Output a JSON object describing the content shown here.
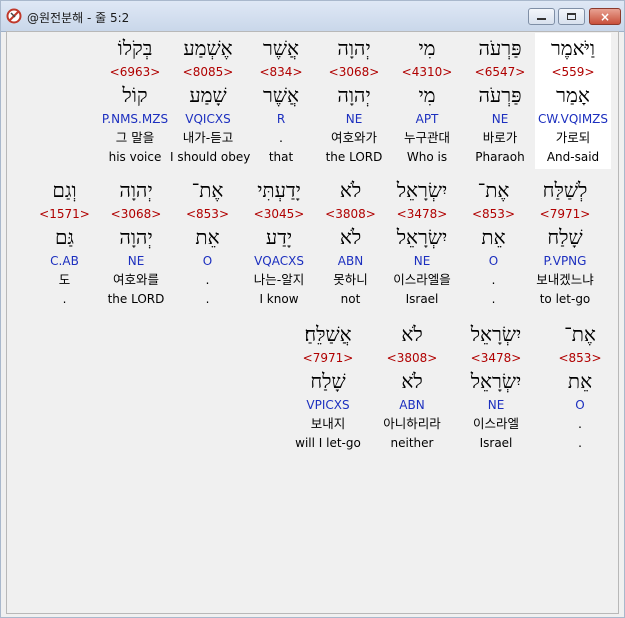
{
  "window": {
    "title": "@원전분해 - 줄 5:2",
    "buttons": {
      "minimize": "minimize",
      "maximize": "maximize",
      "close": "×"
    }
  },
  "rows": [
    {
      "words": [
        {
          "hebrew": "וַיֹּאמֶר",
          "strong": "<559>",
          "lemma": "אָמַר",
          "parse": "CW.VQIMZS",
          "korean": "가로되",
          "english": "And-said",
          "highlight": true
        },
        {
          "hebrew": "פַּרְעֹה",
          "strong": "<6547>",
          "lemma": "פַּרְעֹה",
          "parse": "NE",
          "korean": "바로가",
          "english": "Pharaoh"
        },
        {
          "hebrew": "מִי",
          "strong": "<4310>",
          "lemma": "מִי",
          "parse": "APT",
          "korean": "누구관대",
          "english": "Who is"
        },
        {
          "hebrew": "יְהוָה",
          "strong": "<3068>",
          "lemma": "יְהוָה",
          "parse": "NE",
          "korean": "여호와가",
          "english": "the LORD"
        },
        {
          "hebrew": "אֲשֶׁר",
          "strong": "<834>",
          "lemma": "אֲשֶׁר",
          "parse": "R",
          "korean": ".",
          "english": "that"
        },
        {
          "hebrew": "אֶשְׁמַע",
          "strong": "<8085>",
          "lemma": "שָׁמַע",
          "parse": "VQICXS",
          "korean": "내가-듣고",
          "english": "I should obey"
        },
        {
          "hebrew": "בְּקֹלוֹ",
          "strong": "<6963>",
          "lemma": "קוֹל",
          "parse": "P.NMS.MZS",
          "korean": "그 말을",
          "english": "his voice"
        }
      ]
    },
    {
      "words": [
        {
          "hebrew": "לְשַׁלַּח",
          "strong": "<7971>",
          "lemma": "שָׁלַח",
          "parse": "P.VPNG",
          "korean": "보내겠느냐",
          "english": "to let-go"
        },
        {
          "hebrew": "אֶת־",
          "strong": "<853>",
          "lemma": "אֵת",
          "parse": "O",
          "korean": ".",
          "english": "."
        },
        {
          "hebrew": "יִשְׂרָאֵל",
          "strong": "<3478>",
          "lemma": "יִשְׂרָאֵל",
          "parse": "NE",
          "korean": "이스라엘을",
          "english": "Israel"
        },
        {
          "hebrew": "לֹא",
          "strong": "<3808>",
          "lemma": "לֹא",
          "parse": "ABN",
          "korean": "못하니",
          "english": "not"
        },
        {
          "hebrew": "יָדַעְתִּי",
          "strong": "<3045>",
          "lemma": "יָדַע",
          "parse": "VQACXS",
          "korean": "나는-알지",
          "english": "I know"
        },
        {
          "hebrew": "אֶת־",
          "strong": "<853>",
          "lemma": "אֵת",
          "parse": "O",
          "korean": ".",
          "english": "."
        },
        {
          "hebrew": "יְהוָה",
          "strong": "<3068>",
          "lemma": "יְהוָה",
          "parse": "NE",
          "korean": "여호와를",
          "english": "the LORD"
        },
        {
          "hebrew": "וְגַם",
          "strong": "<1571>",
          "lemma": "גַּם",
          "parse": "C.AB",
          "korean": "도",
          "english": "."
        }
      ]
    },
    {
      "words": [
        {
          "hebrew": "אֶת־",
          "strong": "<853>",
          "lemma": "אֵת",
          "parse": "O",
          "korean": ".",
          "english": "."
        },
        {
          "hebrew": "יִשְׂרָאֵל",
          "strong": "<3478>",
          "lemma": "יִשְׂרָאֵל",
          "parse": "NE",
          "korean": "이스라엘",
          "english": "Israel"
        },
        {
          "hebrew": "לֹא",
          "strong": "<3808>",
          "lemma": "לֹא",
          "parse": "ABN",
          "korean": "아니하리라",
          "english": "neither"
        },
        {
          "hebrew": "אֲשַׁלֵּחַ׃",
          "strong": "<7971>",
          "lemma": "שָׁלַח",
          "parse": "VPICXS",
          "korean": "보내지",
          "english": "will I let-go"
        }
      ]
    }
  ]
}
